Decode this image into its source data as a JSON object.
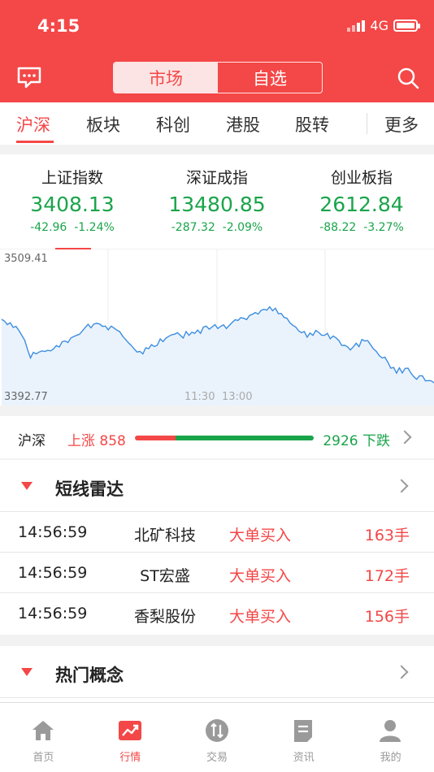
{
  "status": {
    "time": "4:15",
    "network": "4G"
  },
  "header": {
    "segments": [
      {
        "label": "市场",
        "active": true
      },
      {
        "label": "自选",
        "active": false
      }
    ]
  },
  "tabs": {
    "items": [
      "沪深",
      "板块",
      "科创",
      "港股",
      "股转"
    ],
    "more": "更多",
    "active_index": 0
  },
  "indices": [
    {
      "name": "上证指数",
      "value": "3408.13",
      "change": "-42.96",
      "pct": "-1.24%"
    },
    {
      "name": "深证成指",
      "value": "13480.85",
      "change": "-287.32",
      "pct": "-2.09%"
    },
    {
      "name": "创业板指",
      "value": "2612.84",
      "change": "-88.22",
      "pct": "-3.27%"
    }
  ],
  "chart_data": {
    "type": "area",
    "y_max_label": "3509.41",
    "y_min_label": "3392.77",
    "ylim": [
      3392.77,
      3509.41
    ],
    "x_tick_labels": [
      "11:30",
      "13:00"
    ],
    "values": [
      3458.2,
      3456.8,
      3454.0,
      3455.5,
      3451.8,
      3452.6,
      3449.3,
      3445.6,
      3441.7,
      3434.3,
      3427.7,
      3432.1,
      3430.9,
      3432.4,
      3433.3,
      3432.8,
      3433.7,
      3433.3,
      3434.9,
      3437.5,
      3436.3,
      3440.5,
      3441.1,
      3439.9,
      3443.4,
      3444.6,
      3445.5,
      3446.4,
      3449.0,
      3451.8,
      3454.2,
      3451.5,
      3454.5,
      3455.0,
      3454.5,
      3452.6,
      3452.8,
      3449.9,
      3452.8,
      3451.3,
      3449.6,
      3448.4,
      3444.8,
      3442.3,
      3439.6,
      3437.5,
      3434.8,
      3432.4,
      3432.9,
      3430.9,
      3435.7,
      3435.0,
      3438.2,
      3436.7,
      3437.7,
      3442.7,
      3440.6,
      3443.4,
      3444.8,
      3446.0,
      3446.4,
      3447.6,
      3445.5,
      3443.4,
      3448.5,
      3445.5,
      3448.0,
      3447.1,
      3449.7,
      3447.1,
      3452.1,
      3452.8,
      3450.4,
      3452.1,
      3454.0,
      3450.9,
      3452.6,
      3453.8,
      3450.9,
      3453.4,
      3455.7,
      3457.8,
      3457.3,
      3459.5,
      3459.0,
      3458.0,
      3461.2,
      3462.2,
      3463.5,
      3462.3,
      3465.2,
      3466.1,
      3465.4,
      3468.0,
      3465.0,
      3466.9,
      3462.6,
      3462.8,
      3459.7,
      3459.0,
      3455.5,
      3453.5,
      3452.1,
      3449.2,
      3447.6,
      3448.5,
      3444.1,
      3447.4,
      3445.5,
      3449.4,
      3447.9,
      3445.7,
      3445.5,
      3447.1,
      3442.8,
      3445.0,
      3443.6,
      3441.4,
      3437.5,
      3437.7,
      3436.5,
      3434.0,
      3436.5,
      3439.3,
      3436.7,
      3442.3,
      3441.1,
      3441.4,
      3438.1,
      3434.9,
      3432.8,
      3429.6,
      3427.7,
      3428.3,
      3424.2,
      3419.6,
      3420.2,
      3415.8,
      3419.9,
      3415.9,
      3419.5,
      3419.6,
      3415.8,
      3412.9,
      3410.9,
      3413.7,
      3413.6,
      3409.7,
      3409.9,
      3409.7,
      3408.1
    ]
  },
  "updown": {
    "label": "沪深",
    "up_text": "上涨 858",
    "down_text": "2926 下跌",
    "up_count": 858,
    "down_count": 2926
  },
  "radar": {
    "title": "短线雷达",
    "rows": [
      {
        "time": "14:56:59",
        "name": "北矿科技",
        "type": "大单买入",
        "volume": "163手"
      },
      {
        "time": "14:56:59",
        "name": "ST宏盛",
        "type": "大单买入",
        "volume": "172手"
      },
      {
        "time": "14:56:59",
        "name": "香梨股份",
        "type": "大单买入",
        "volume": "156手"
      }
    ]
  },
  "concepts": {
    "title": "热门概念"
  },
  "bottom_nav": [
    {
      "label": "首页",
      "icon": "home-icon",
      "active": false
    },
    {
      "label": "行情",
      "icon": "chart-icon",
      "active": true
    },
    {
      "label": "交易",
      "icon": "trade-icon",
      "active": false
    },
    {
      "label": "资讯",
      "icon": "news-icon",
      "active": false
    },
    {
      "label": "我的",
      "icon": "profile-icon",
      "active": false
    }
  ],
  "colors": {
    "accent": "#f44747",
    "rise": "#f44747",
    "fall": "#1aa44a",
    "line": "#3d8ee0",
    "area": "#eaf3fc"
  }
}
